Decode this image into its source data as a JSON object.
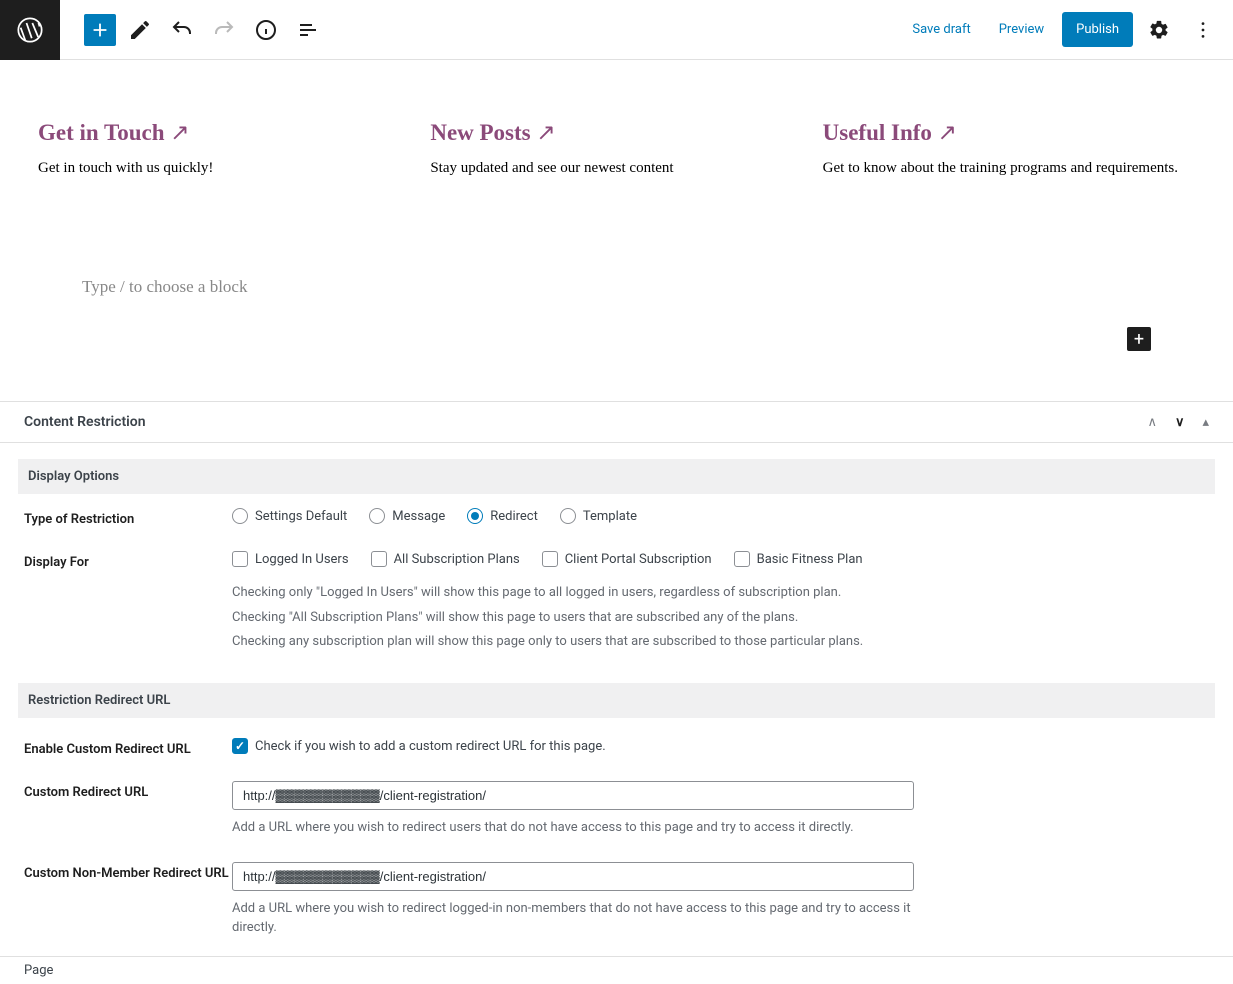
{
  "toolbar": {
    "save_draft": "Save draft",
    "preview": "Preview",
    "publish": "Publish"
  },
  "content": {
    "cols": [
      {
        "heading": "Get in Touch",
        "desc": "Get in touch with us quickly!"
      },
      {
        "heading": "New Posts",
        "desc": "Stay updated and see our newest content"
      },
      {
        "heading": "Useful Info",
        "desc": "Get to know about the training programs and requirements."
      }
    ],
    "placeholder": "Type / to choose a block"
  },
  "panel": {
    "title": "Content Restriction",
    "section_display": "Display Options",
    "type_label": "Type of Restriction",
    "types": [
      {
        "label": "Settings Default",
        "checked": false
      },
      {
        "label": "Message",
        "checked": false
      },
      {
        "label": "Redirect",
        "checked": true
      },
      {
        "label": "Template",
        "checked": false
      }
    ],
    "display_for_label": "Display For",
    "display_for": [
      {
        "label": "Logged In Users",
        "checked": false
      },
      {
        "label": "All Subscription Plans",
        "checked": false
      },
      {
        "label": "Client Portal Subscription",
        "checked": false
      },
      {
        "label": "Basic Fitness Plan",
        "checked": false
      }
    ],
    "help1": "Checking only \"Logged In Users\" will show this page to all logged in users, regardless of subscription plan.",
    "help2": "Checking \"All Subscription Plans\" will show this page to users that are subscribed any of the plans.",
    "help3": "Checking any subscription plan will show this page only to users that are subscribed to those particular plans.",
    "section_redirect": "Restriction Redirect URL",
    "enable_label": "Enable Custom Redirect URL",
    "enable_desc": "Check if you wish to add a custom redirect URL for this page.",
    "enable_checked": true,
    "custom_url_label": "Custom Redirect URL",
    "custom_url_value": "http://▓▓▓▓▓▓▓▓▓▓▓/client-registration/",
    "custom_url_help": "Add a URL where you wish to redirect users that do not have access to this page and try to access it directly.",
    "nonmember_url_label": "Custom Non-Member Redirect URL",
    "nonmember_url_value": "http://▓▓▓▓▓▓▓▓▓▓▓/client-registration/",
    "nonmember_url_help": "Add a URL where you wish to redirect logged-in non-members that do not have access to this page and try to access it directly."
  },
  "footer": "Page"
}
